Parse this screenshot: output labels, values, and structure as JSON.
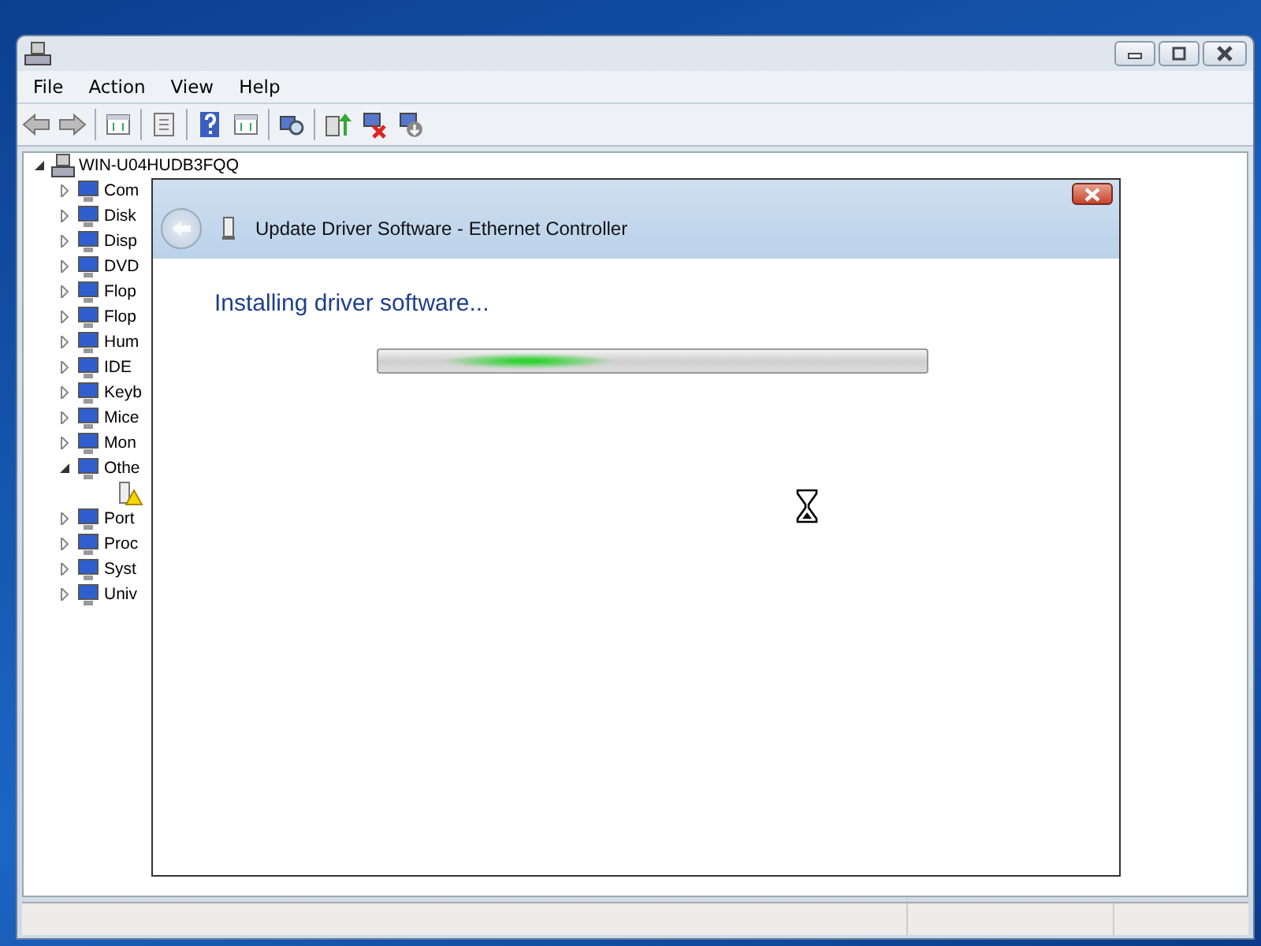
{
  "menu": [
    "File",
    "Action",
    "View",
    "Help"
  ],
  "tree": {
    "label": "WIN-U04HUDB3FQQ",
    "expanded": true,
    "children": [
      {
        "label": "Com",
        "expanded": false
      },
      {
        "label": "Disk",
        "expanded": false
      },
      {
        "label": "Disp",
        "expanded": false
      },
      {
        "label": "DVD",
        "expanded": false
      },
      {
        "label": "Flop",
        "expanded": false
      },
      {
        "label": "Flop",
        "expanded": false
      },
      {
        "label": "Hum",
        "expanded": false
      },
      {
        "label": "IDE",
        "expanded": false
      },
      {
        "label": "Keyb",
        "expanded": false
      },
      {
        "label": "Mice",
        "expanded": false
      },
      {
        "label": "Mon",
        "expanded": false
      },
      {
        "label": "Othe",
        "expanded": true,
        "children": [
          {
            "warning": true
          }
        ]
      },
      {
        "label": "Port",
        "expanded": false
      },
      {
        "label": "Proc",
        "expanded": false
      },
      {
        "label": "Syst",
        "expanded": false
      },
      {
        "label": "Univ",
        "expanded": false
      }
    ]
  },
  "dialog": {
    "title": "Update Driver Software - Ethernet Controller",
    "heading": "Installing driver software...",
    "progress": {
      "indeterminate": true
    }
  }
}
